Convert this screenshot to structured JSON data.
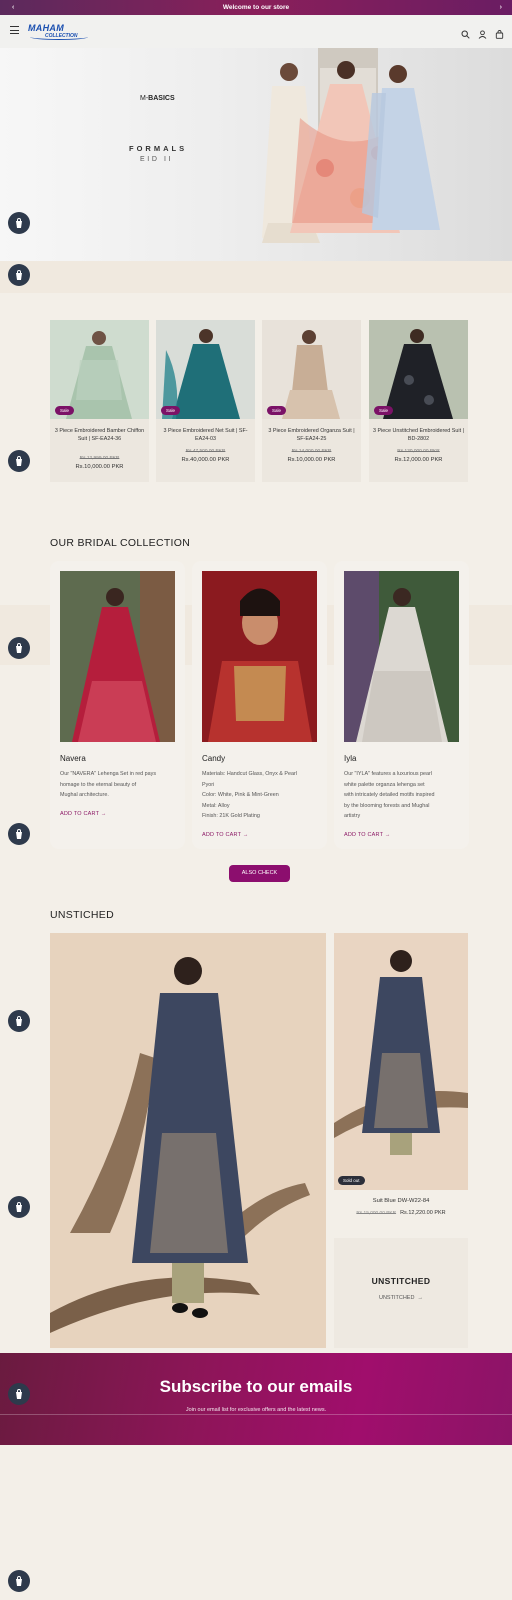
{
  "announcement": {
    "text": "Welcome to our store"
  },
  "header": {
    "logo_line1": "MAHAM",
    "logo_line2": "COLLECTION"
  },
  "hero": {
    "brand_prefix": "M-",
    "brand_name": "BASICS",
    "title": "FORMALS",
    "subtitle": "EID II"
  },
  "sale_products": [
    {
      "badge": "Sale",
      "title": "3 Piece Embroidered Bamber Chiffon Suit | SF-EA24-36",
      "old_price": "Rs.12,999.00 PKR",
      "price": "Rs.10,000.00 PKR"
    },
    {
      "badge": "Sale",
      "title": "3 Piece Embroidered Net Suit | SF-EA24-03",
      "old_price": "Rs.47,500.00 PKR",
      "price": "Rs.40,000.00 PKR"
    },
    {
      "badge": "Sale",
      "title": "3 Piece Embroidered Organza Suit | SF-EA24-25",
      "old_price": "Rs.14,000.00 PKR",
      "price": "Rs.10,000.00 PKR"
    },
    {
      "badge": "Sale",
      "title": "3 Piece Unstitched Embroidered Suit | BD-2802",
      "old_price": "Rs.130,000.00 PKR",
      "price": "Rs.12,000.00 PKR"
    }
  ],
  "bridal": {
    "heading": "OUR BRIDAL COLLECTION",
    "items": [
      {
        "name": "Navera",
        "desc": [
          "Our \"NAVERA\" Lehenga Set in red pays",
          "homage to the eternal beauty of",
          "Mughal architecture."
        ],
        "cta": "ADD TO CART"
      },
      {
        "name": "Candy",
        "desc": [
          "Materials: Handcut Glass, Onyx & Pearl",
          "Pyori",
          "Color: White, Pink & Mint-Green",
          "Metal: Alloy",
          "Finish: 21K Gold Plating"
        ],
        "cta": "ADD TO CART"
      },
      {
        "name": "Iyla",
        "desc": [
          "Our \"IYLA\" features a luxurious pearl",
          "white palette organza lehenga set",
          "with intricately detailed motifs inspired",
          "by the blooming forests and Mughal",
          "artistry"
        ],
        "cta": "ADD TO CART"
      }
    ],
    "button": "ALSO CHECK"
  },
  "unstiched": {
    "heading": "UNSTICHED",
    "product": {
      "badge": "Sold out",
      "name": "Suit Blue DW-W22-84",
      "old_price": "Rs.15,000.00 PKR",
      "price": "Rs.12,220.00 PKR"
    },
    "collection_title": "UNSTITCHED",
    "collection_link": "UNSTITCHED"
  },
  "subscribe": {
    "title": "Subscribe to our emails",
    "subtitle": "Join our email list for exclusive offers and the latest news."
  }
}
